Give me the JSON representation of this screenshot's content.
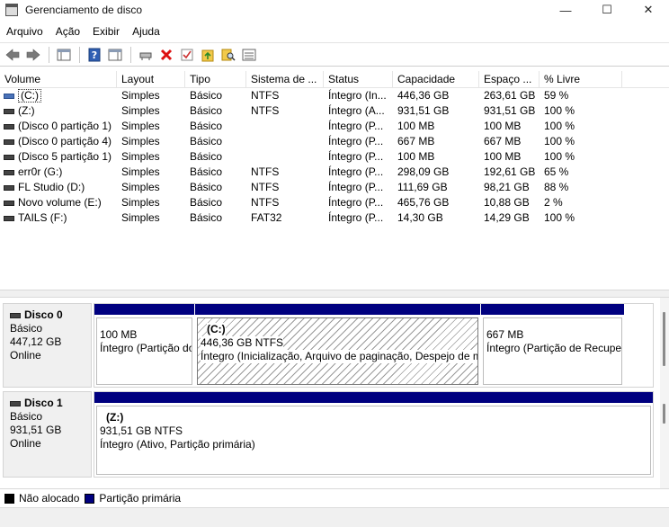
{
  "window": {
    "title": "Gerenciamento de disco",
    "minimize": "—",
    "maximize": "☐",
    "close": "✕"
  },
  "menu": [
    "Arquivo",
    "Ação",
    "Exibir",
    "Ajuda"
  ],
  "toolbar_icons": [
    "back-icon",
    "forward-icon",
    "properties-pane-icon",
    "help-icon",
    "show-hide-icon",
    "connect-icon",
    "delete-icon",
    "check-icon",
    "folder-up-icon",
    "search-icon",
    "list-icon"
  ],
  "columns": [
    "Volume",
    "Layout",
    "Tipo",
    "Sistema de ...",
    "Status",
    "Capacidade",
    "Espaço ...",
    "% Livre"
  ],
  "volumes": [
    {
      "volume": "(C:)",
      "layout": "Simples",
      "tipo": "Básico",
      "sistema": "NTFS",
      "status": "Íntegro (In...",
      "capacidade": "446,36 GB",
      "espaco": "263,61 GB",
      "livre": "59 %"
    },
    {
      "volume": "(Z:)",
      "layout": "Simples",
      "tipo": "Básico",
      "sistema": "NTFS",
      "status": "Íntegro (A...",
      "capacidade": "931,51 GB",
      "espaco": "931,51 GB",
      "livre": "100 %"
    },
    {
      "volume": "(Disco 0 partição 1)",
      "layout": "Simples",
      "tipo": "Básico",
      "sistema": "",
      "status": "Íntegro (P...",
      "capacidade": "100 MB",
      "espaco": "100 MB",
      "livre": "100 %"
    },
    {
      "volume": "(Disco 0 partição 4)",
      "layout": "Simples",
      "tipo": "Básico",
      "sistema": "",
      "status": "Íntegro (P...",
      "capacidade": "667 MB",
      "espaco": "667 MB",
      "livre": "100 %"
    },
    {
      "volume": "(Disco 5 partição 1)",
      "layout": "Simples",
      "tipo": "Básico",
      "sistema": "",
      "status": "Íntegro (P...",
      "capacidade": "100 MB",
      "espaco": "100 MB",
      "livre": "100 %"
    },
    {
      "volume": "err0r (G:)",
      "layout": "Simples",
      "tipo": "Básico",
      "sistema": "NTFS",
      "status": "Íntegro (P...",
      "capacidade": "298,09 GB",
      "espaco": "192,61 GB",
      "livre": "65 %"
    },
    {
      "volume": "FL Studio (D:)",
      "layout": "Simples",
      "tipo": "Básico",
      "sistema": "NTFS",
      "status": "Íntegro (P...",
      "capacidade": "111,69 GB",
      "espaco": "98,21 GB",
      "livre": "88 %"
    },
    {
      "volume": "Novo volume (E:)",
      "layout": "Simples",
      "tipo": "Básico",
      "sistema": "NTFS",
      "status": "Íntegro (P...",
      "capacidade": "465,76 GB",
      "espaco": "10,88 GB",
      "livre": "2 %"
    },
    {
      "volume": "TAILS (F:)",
      "layout": "Simples",
      "tipo": "Básico",
      "sistema": "FAT32",
      "status": "Íntegro (P...",
      "capacidade": "14,30 GB",
      "espaco": "14,29 GB",
      "livre": "100 %"
    }
  ],
  "disks": [
    {
      "name": "Disco 0",
      "type": "Básico",
      "size": "447,12 GB",
      "state": "Online",
      "partitions": [
        {
          "name": "",
          "size": "100 MB",
          "status": "Íntegro (Partição do Sistema EFI)"
        },
        {
          "name": "(C:)",
          "size": "446,36 GB NTFS",
          "status": "Íntegro (Inicialização, Arquivo de paginação, Despejo de memória, Partição primária)"
        },
        {
          "name": "",
          "size": "667 MB",
          "status": "Íntegro (Partição de Recuperação)"
        }
      ]
    },
    {
      "name": "Disco 1",
      "type": "Básico",
      "size": "931,51 GB",
      "state": "Online",
      "partitions": [
        {
          "name": "(Z:)",
          "size": "931,51 GB NTFS",
          "status": "Íntegro (Ativo, Partição primária)"
        }
      ]
    }
  ],
  "legend": [
    {
      "label": "Não alocado",
      "color": "#000000"
    },
    {
      "label": "Partição primária",
      "color": "#00007f"
    }
  ]
}
